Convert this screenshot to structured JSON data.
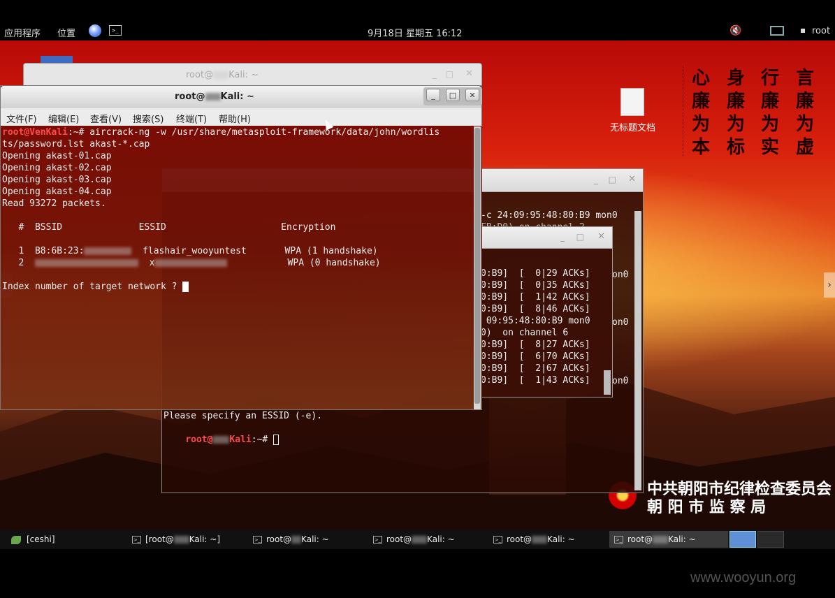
{
  "top_panel": {
    "applications": "应用程序",
    "places": "位置",
    "clock": "9月18日 星期五 16:12",
    "user": "root"
  },
  "desktop": {
    "file_icon_label": "无标题文档",
    "slogans": [
      "心廉为本",
      "身廉为标",
      "行廉为实",
      "言廉为虚"
    ],
    "org_line1": "中共朝阳市纪律检查委员会",
    "org_line2": "朝 阳 市 监 察 局",
    "watermark": "www.wooyun.org"
  },
  "back_window": {
    "title_prefix": "root@",
    "title_suffix": "Kali: ~"
  },
  "main_window": {
    "title_prefix": "root@",
    "title_suffix": "Kali: ~",
    "menu": [
      "文件(F)",
      "编辑(E)",
      "查看(V)",
      "搜索(S)",
      "终端(T)",
      "帮助(H)"
    ],
    "prompt": "root@VenKali",
    "prompt_tail": ":~#",
    "command": " aircrack-ng -w /usr/share/metasploit-framework/data/john/wordlis",
    "command_cont": "ts/password.lst akast-*.cap",
    "opening": [
      "Opening akast-01.cap",
      "Opening akast-02.cap",
      "Opening akast-03.cap",
      "Opening akast-04.cap"
    ],
    "read": "Read 93272 packets.",
    "header": "   #  BSSID              ESSID                     Encryption",
    "row1_num": "   1  B8:6B:23:",
    "row1_rest": "flashair_wooyuntest       WPA (1 handshake)",
    "row2_num": "   2  ",
    "row2_x": "x",
    "row2_enc": "WPA (0 handshake)",
    "question": "Index number of target network ? "
  },
  "mid_window": {
    "top_line": "-c 24:09:95:48:80:B9 mon0",
    "cut_line": "FB:D0) on channel 2",
    "right_mon": [
      "on0",
      "on0",
      "on0"
    ],
    "bottom_line1": "Please specify an ESSID (-e).",
    "bottom_prompt_tail": ":~#"
  },
  "front_small_window": {
    "lines": [
      "0:B9]  [  0|29 ACKs]",
      "0:B9]  [  0|35 ACKs]",
      "0:B9]  [  1|42 ACKs]",
      "0:B9]  [  8|46 ACKs]",
      " 09:95:48:80:B9 mon0",
      "0)  on channel 6",
      "0:B9]  [  8|27 ACKs]",
      "0:B9]  [  6|70 ACKs]",
      "0:B9]  [  2|67 ACKs]",
      "0:B9]  [  1|43 ACKs]"
    ]
  },
  "taskbar": {
    "ceshi": "[ceshi]",
    "tasks": [
      "[root@",
      "root@",
      "root@",
      "root@",
      "root@"
    ],
    "task_first_suffix": "Kali: ~]",
    "task_suffix": "Kali: ~"
  },
  "colors": {
    "prompt": "#ff4a4a",
    "panel": "#000000",
    "terminal_text": "#f0f0f0"
  }
}
